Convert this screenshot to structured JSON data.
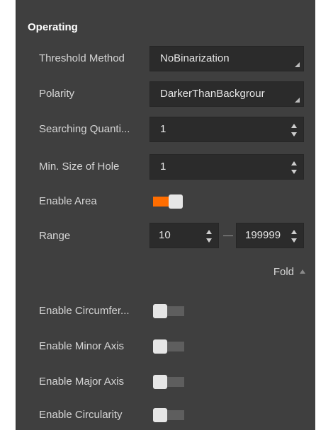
{
  "section": {
    "title": "Operating"
  },
  "threshold_method": {
    "label": "Threshold Method",
    "value": "NoBinarization"
  },
  "polarity": {
    "label": "Polarity",
    "value": "DarkerThanBackgrour"
  },
  "searching_quantity": {
    "label": "Searching Quanti...",
    "value": "1"
  },
  "min_hole_size": {
    "label": "Min. Size of Hole",
    "value": "1"
  },
  "enable_area": {
    "label": "Enable Area",
    "on": true
  },
  "range": {
    "label": "Range",
    "min": "10",
    "max": "199999"
  },
  "fold": {
    "label": "Fold"
  },
  "enable_circumference": {
    "label": "Enable Circumfer...",
    "on": false
  },
  "enable_minor_axis": {
    "label": "Enable Minor Axis",
    "on": false
  },
  "enable_major_axis": {
    "label": "Enable Major Axis",
    "on": false
  },
  "enable_circularity": {
    "label": "Enable Circularity",
    "on": false
  },
  "colors": {
    "accent": "#ff6d00",
    "panel": "#3f3f3f",
    "field": "#2b2b2b"
  }
}
